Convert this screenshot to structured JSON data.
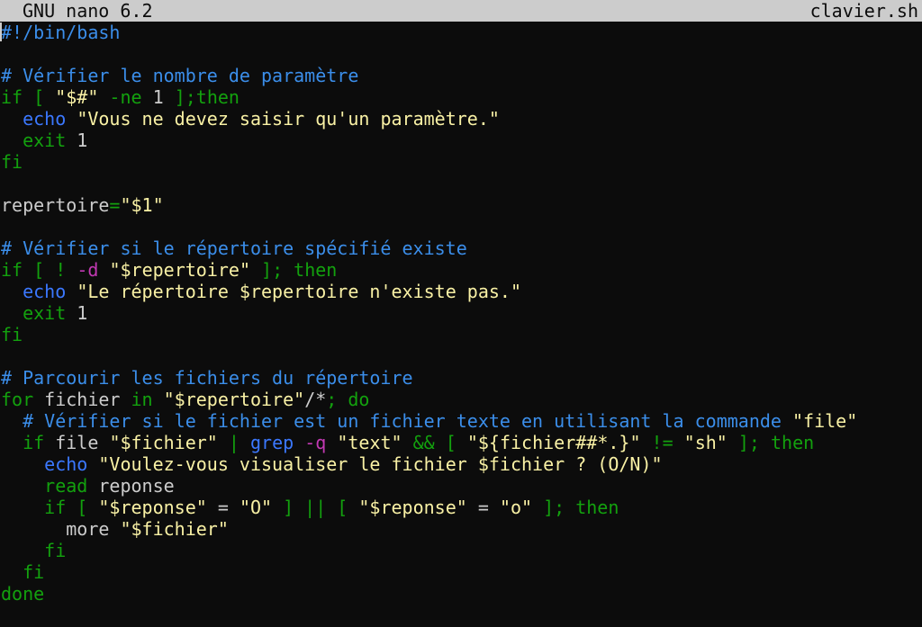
{
  "titlebar": {
    "app_name": "GNU nano 6.2",
    "file_name": "clavier.sh"
  },
  "editor": {
    "lines": [
      [
        {
          "t": "#!/bin/bash",
          "c": "comment"
        }
      ],
      [],
      [
        {
          "t": "# Vérifier le nombre de paramètre",
          "c": "comment"
        }
      ],
      [
        {
          "t": "if",
          "c": "keyword"
        },
        {
          "t": " [ ",
          "c": "keyword"
        },
        {
          "t": "\"$#\"",
          "c": "string"
        },
        {
          "t": " -ne ",
          "c": "keyword"
        },
        {
          "t": "1",
          "c": "plain"
        },
        {
          "t": " ];",
          "c": "keyword"
        },
        {
          "t": "then",
          "c": "keyword"
        }
      ],
      [
        {
          "t": "  ",
          "c": "plain"
        },
        {
          "t": "echo",
          "c": "builtin"
        },
        {
          "t": " ",
          "c": "plain"
        },
        {
          "t": "\"Vous ne devez saisir qu'un paramètre.\"",
          "c": "string"
        }
      ],
      [
        {
          "t": "  ",
          "c": "plain"
        },
        {
          "t": "exit",
          "c": "keyword"
        },
        {
          "t": " 1",
          "c": "plain"
        }
      ],
      [
        {
          "t": "fi",
          "c": "keyword"
        }
      ],
      [],
      [
        {
          "t": "repertoire",
          "c": "plain"
        },
        {
          "t": "=",
          "c": "keyword"
        },
        {
          "t": "\"$1\"",
          "c": "string"
        }
      ],
      [],
      [
        {
          "t": "# Vérifier si le répertoire spécifié existe",
          "c": "comment"
        }
      ],
      [
        {
          "t": "if",
          "c": "keyword"
        },
        {
          "t": " [ ! ",
          "c": "keyword"
        },
        {
          "t": "-d",
          "c": "option"
        },
        {
          "t": " ",
          "c": "plain"
        },
        {
          "t": "\"$repertoire\"",
          "c": "string"
        },
        {
          "t": " ]; then",
          "c": "keyword"
        }
      ],
      [
        {
          "t": "  ",
          "c": "plain"
        },
        {
          "t": "echo",
          "c": "builtin"
        },
        {
          "t": " ",
          "c": "plain"
        },
        {
          "t": "\"Le répertoire $repertoire n'existe pas.\"",
          "c": "string"
        }
      ],
      [
        {
          "t": "  ",
          "c": "plain"
        },
        {
          "t": "exit",
          "c": "keyword"
        },
        {
          "t": " 1",
          "c": "plain"
        }
      ],
      [
        {
          "t": "fi",
          "c": "keyword"
        }
      ],
      [],
      [
        {
          "t": "# Parcourir les fichiers du répertoire",
          "c": "comment"
        }
      ],
      [
        {
          "t": "for",
          "c": "keyword"
        },
        {
          "t": " fichier ",
          "c": "plain"
        },
        {
          "t": "in",
          "c": "keyword"
        },
        {
          "t": " ",
          "c": "plain"
        },
        {
          "t": "\"$repertoire\"",
          "c": "string"
        },
        {
          "t": "/*",
          "c": "plain"
        },
        {
          "t": "; do",
          "c": "keyword"
        }
      ],
      [
        {
          "t": "  ",
          "c": "plain"
        },
        {
          "t": "# Vérifier si le fichier est un fichier texte en utilisant la commande ",
          "c": "comment"
        },
        {
          "t": "\"file\"",
          "c": "string"
        }
      ],
      [
        {
          "t": "  ",
          "c": "plain"
        },
        {
          "t": "if",
          "c": "keyword"
        },
        {
          "t": " file ",
          "c": "plain"
        },
        {
          "t": "\"$fichier\"",
          "c": "string"
        },
        {
          "t": " | ",
          "c": "keyword"
        },
        {
          "t": "grep",
          "c": "builtin"
        },
        {
          "t": " ",
          "c": "plain"
        },
        {
          "t": "-q",
          "c": "option"
        },
        {
          "t": " ",
          "c": "plain"
        },
        {
          "t": "\"text\"",
          "c": "string"
        },
        {
          "t": " && [ ",
          "c": "keyword"
        },
        {
          "t": "\"${fichier##*.}\"",
          "c": "string"
        },
        {
          "t": " != ",
          "c": "keyword"
        },
        {
          "t": "\"sh\"",
          "c": "string"
        },
        {
          "t": " ]; then",
          "c": "keyword"
        }
      ],
      [
        {
          "t": "    ",
          "c": "plain"
        },
        {
          "t": "echo",
          "c": "builtin"
        },
        {
          "t": " ",
          "c": "plain"
        },
        {
          "t": "\"Voulez-vous visualiser le fichier $fichier ? (O/N)\"",
          "c": "string"
        }
      ],
      [
        {
          "t": "    ",
          "c": "plain"
        },
        {
          "t": "read",
          "c": "keyword"
        },
        {
          "t": " reponse",
          "c": "plain"
        }
      ],
      [
        {
          "t": "    ",
          "c": "plain"
        },
        {
          "t": "if",
          "c": "keyword"
        },
        {
          "t": " [ ",
          "c": "keyword"
        },
        {
          "t": "\"$reponse\"",
          "c": "string"
        },
        {
          "t": " = ",
          "c": "plain"
        },
        {
          "t": "\"O\"",
          "c": "string"
        },
        {
          "t": " ] || [ ",
          "c": "keyword"
        },
        {
          "t": "\"$reponse\"",
          "c": "string"
        },
        {
          "t": " = ",
          "c": "plain"
        },
        {
          "t": "\"o\"",
          "c": "string"
        },
        {
          "t": " ]; then",
          "c": "keyword"
        }
      ],
      [
        {
          "t": "      more ",
          "c": "plain"
        },
        {
          "t": "\"$fichier\"",
          "c": "string"
        }
      ],
      [
        {
          "t": "    ",
          "c": "plain"
        },
        {
          "t": "fi",
          "c": "keyword"
        }
      ],
      [
        {
          "t": "  ",
          "c": "plain"
        },
        {
          "t": "fi",
          "c": "keyword"
        }
      ],
      [
        {
          "t": "done",
          "c": "keyword"
        }
      ]
    ]
  }
}
